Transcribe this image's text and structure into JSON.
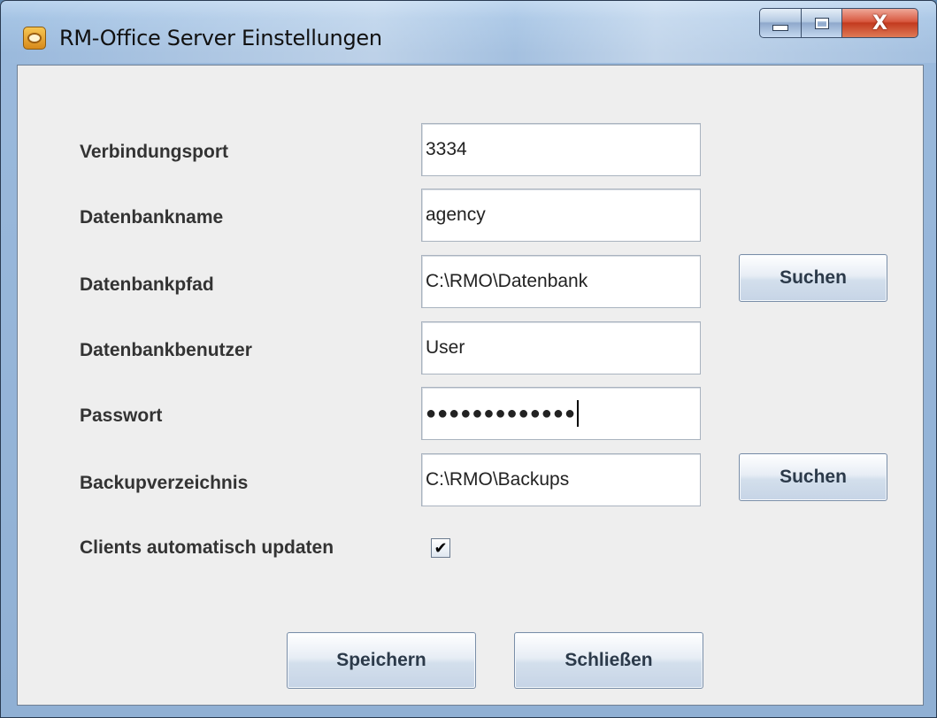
{
  "window": {
    "title": "RM-Office Server Einstellungen",
    "close_glyph": "X"
  },
  "form": {
    "port": {
      "label": "Verbindungsport",
      "value": "3334"
    },
    "dbname": {
      "label": "Datenbankname",
      "value": "agency"
    },
    "dbpath": {
      "label": "Datenbankpfad",
      "value": "C:\\RMO\\Datenbank",
      "browse_label": "Suchen"
    },
    "dbuser": {
      "label": "Datenbankbenutzer",
      "value": "User"
    },
    "password": {
      "label": "Passwort",
      "masked_value": "●●●●●●●●●●●●●"
    },
    "backup": {
      "label": "Backupverzeichnis",
      "value": "C:\\RMO\\Backups",
      "browse_label": "Suchen"
    },
    "autoupdate": {
      "label": "Clients automatisch updaten",
      "checked": true,
      "check_glyph": "✔"
    }
  },
  "actions": {
    "save_label": "Speichern",
    "close_label": "Schließen"
  },
  "icons": {
    "app": "rm-office-app-icon",
    "minimize": "minimize-icon",
    "maximize": "maximize-icon",
    "close": "close-icon"
  },
  "colors": {
    "client_bg": "#eeeeee",
    "close_button": "#c8402a",
    "frame": "#9ab9dc"
  }
}
